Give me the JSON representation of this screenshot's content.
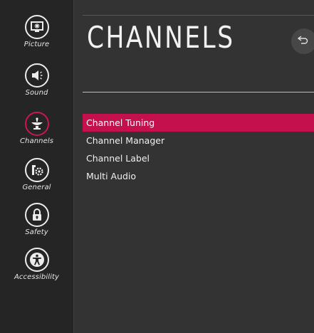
{
  "sidebar": {
    "items": [
      {
        "label": "Picture",
        "icon": "picture-icon"
      },
      {
        "label": "Sound",
        "icon": "sound-icon"
      },
      {
        "label": "Channels",
        "icon": "channels-icon",
        "active": true
      },
      {
        "label": "General",
        "icon": "general-icon"
      },
      {
        "label": "Safety",
        "icon": "lock-icon"
      },
      {
        "label": "Accessibility",
        "icon": "accessibility-icon"
      }
    ]
  },
  "header": {
    "title": "CHANNELS",
    "back_icon": "back-arrow-icon"
  },
  "menu": {
    "items": [
      {
        "label": "Channel Tuning",
        "selected": true
      },
      {
        "label": "Channel Manager"
      },
      {
        "label": "Channel Label"
      },
      {
        "label": "Multi Audio"
      }
    ]
  },
  "colors": {
    "accent": "#c5104e",
    "sidebar_bg": "#252525",
    "main_bg": "#333333",
    "text": "#f0f0f0"
  }
}
